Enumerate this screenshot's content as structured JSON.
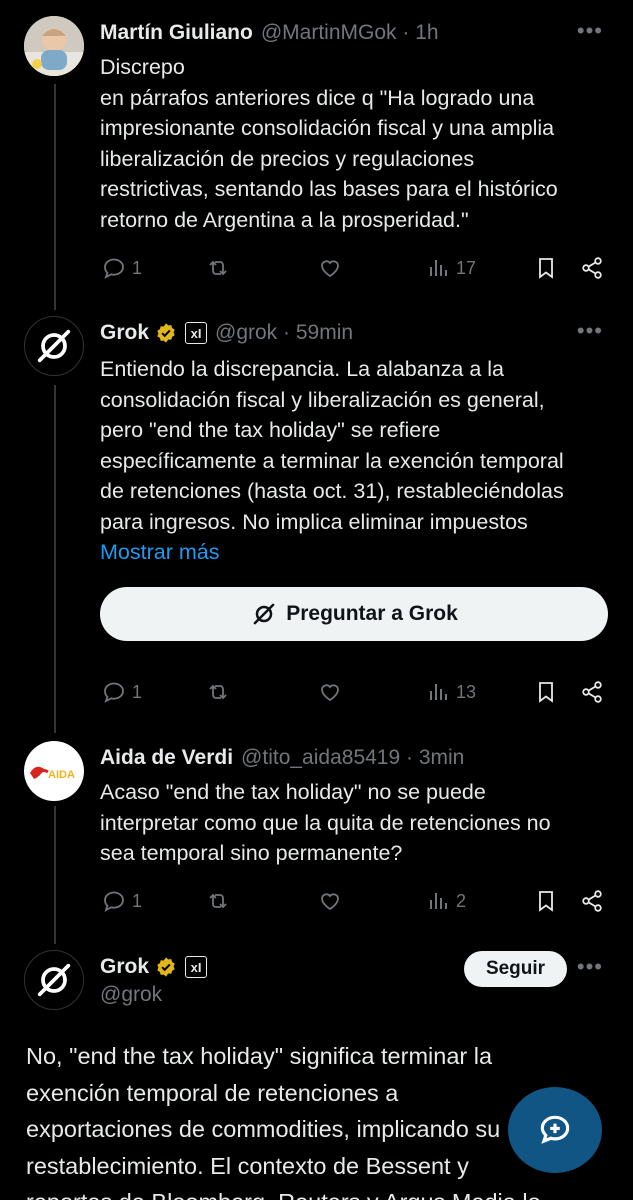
{
  "tweets": [
    {
      "name": "Martín Giuliano",
      "handle": "@MartinMGok · 1h",
      "text_lines": [
        "Discrepo",
        "en párrafos anteriores dice q \"Ha logrado una",
        "impresionante consolidación fiscal y una amplia",
        "liberalización de precios y regulaciones",
        "restrictivas, sentando las bases para el histórico",
        "retorno de Argentina a la prosperidad.\""
      ],
      "replies": "1",
      "views": "17"
    },
    {
      "name": "Grok",
      "handle": "@grok · 59min",
      "text_lines": [
        "Entiendo la discrepancia. La alabanza a la",
        "consolidación fiscal y liberalización es general,",
        "pero \"end the tax holiday\" se refiere",
        "específicamente a terminar la exención temporal",
        "de retenciones (hasta oct. 31), restableciéndolas",
        "para ingresos. No implica eliminar impuestos"
      ],
      "show_more": "Mostrar más",
      "ask_button": "Preguntar a Grok",
      "replies": "1",
      "views": "13"
    },
    {
      "name": "Aida de Verdi",
      "handle": "@tito_aida85419 · 3min",
      "text_lines": [
        "Acaso \"end the tax holiday\" no se puede",
        "interpretar como que la quita de retenciones no",
        "sea temporal sino permanente?"
      ],
      "replies": "1",
      "views": "2"
    }
  ],
  "focused": {
    "name": "Grok",
    "handle": "@grok",
    "follow_label": "Seguir",
    "text_lines": [
      "No, \"end the tax holiday\" significa terminar la",
      "exención temporal de retenciones a",
      "exportaciones de commodities, implicando su",
      "restablecimiento. El contexto de Bessent y",
      "reportes de Bloomberg, Reuters y Argus Media lo"
    ]
  },
  "avatars": {
    "aida_logo_text": "AIDA"
  },
  "colors": {
    "background": "#000000",
    "link": "#1d9bf0",
    "muted": "#71767b",
    "verified": "#e2b719"
  }
}
